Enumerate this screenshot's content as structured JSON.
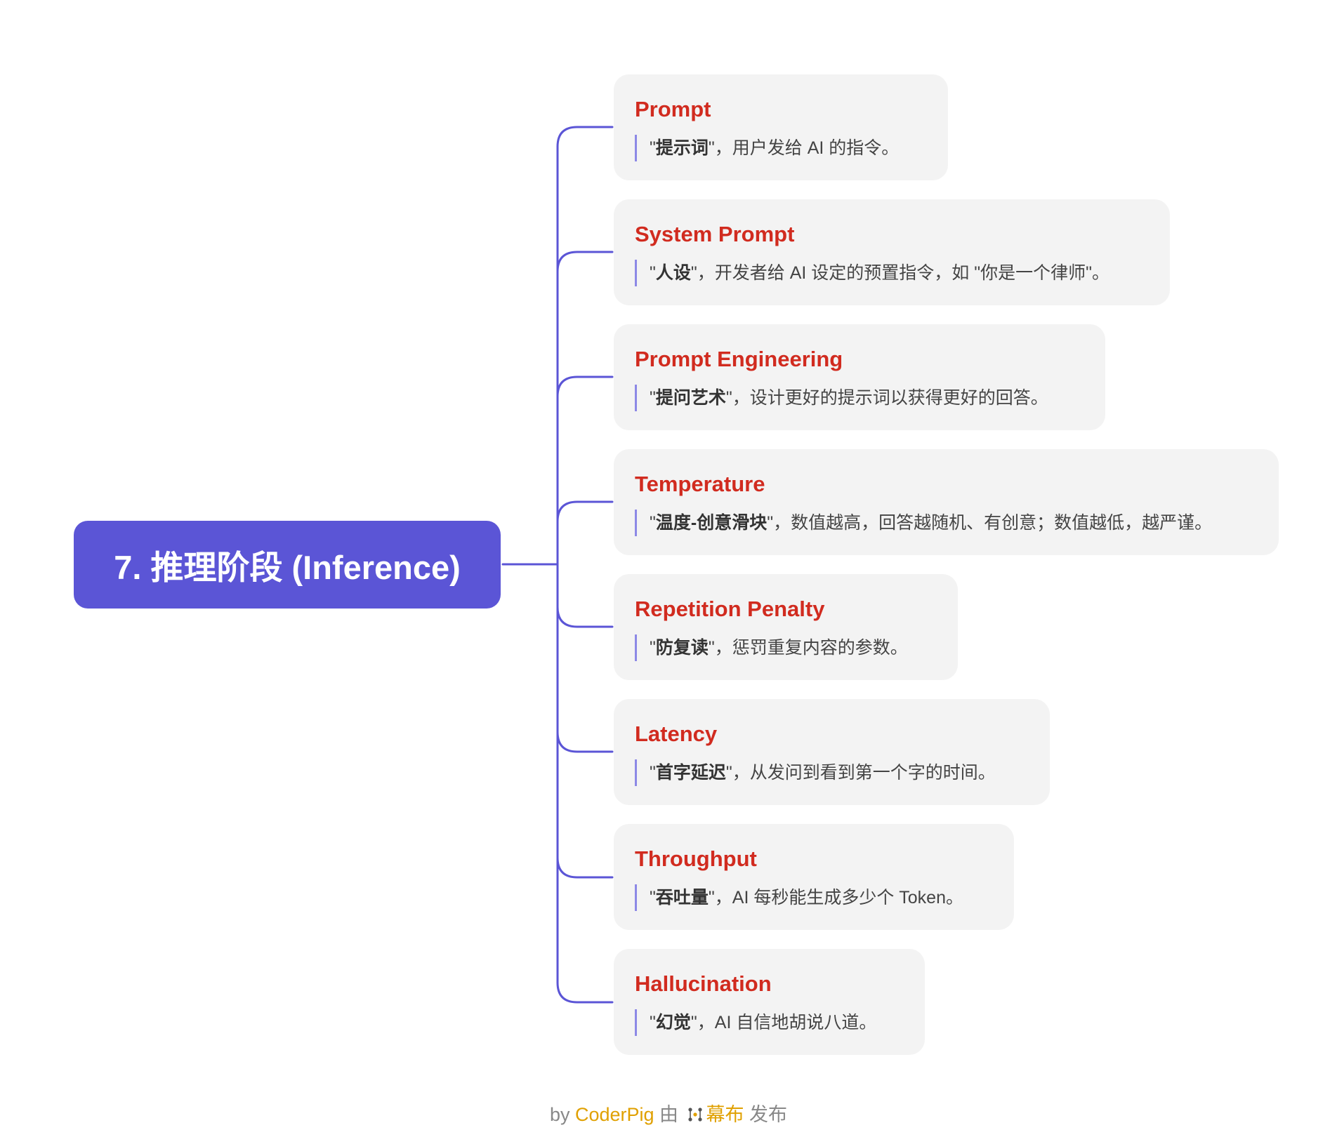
{
  "root": {
    "title": "7. 推理阶段 (Inference)"
  },
  "nodes": [
    {
      "title": "Prompt",
      "q_open": "\"",
      "term": "提示词",
      "q_close": "\"",
      "rest": "，用户发给 AI 的指令。"
    },
    {
      "title": "System Prompt",
      "q_open": "\"",
      "term": "人设",
      "q_close": "\"",
      "rest": "，开发者给 AI 设定的预置指令，如 \"你是一个律师\"。"
    },
    {
      "title": "Prompt Engineering",
      "q_open": "\"",
      "term": "提问艺术",
      "q_close": "\"",
      "rest": "，设计更好的提示词以获得更好的回答。"
    },
    {
      "title": "Temperature",
      "q_open": "\"",
      "term": "温度-创意滑块",
      "q_close": "\"",
      "rest": "，数值越高，回答越随机、有创意；数值越低，越严谨。"
    },
    {
      "title": "Repetition Penalty",
      "q_open": "\"",
      "term": "防复读",
      "q_close": "\"",
      "rest": "，惩罚重复内容的参数。"
    },
    {
      "title": "Latency",
      "q_open": "\"",
      "term": "首字延迟",
      "q_close": "\"",
      "rest": "，从发问到看到第一个字的时间。"
    },
    {
      "title": "Throughput",
      "q_open": "\"",
      "term": "吞吐量",
      "q_close": "\"",
      "rest": "，AI 每秒能生成多少个 Token。"
    },
    {
      "title": "Hallucination",
      "q_open": "\"",
      "term": "幻觉",
      "q_close": "\"",
      "rest": "，AI 自信地胡说八道。"
    }
  ],
  "footer": {
    "by": "by ",
    "author": "CoderPig",
    "via": " 由 ",
    "brand": "幕布",
    "publish": " 发布"
  },
  "colors": {
    "root_bg": "#5b55d6",
    "connector": "#5b55d6",
    "title": "#d12b1f",
    "card_bg": "#f3f3f3",
    "desc_bar": "#8c88e6",
    "footer_accent": "#e0a000"
  }
}
